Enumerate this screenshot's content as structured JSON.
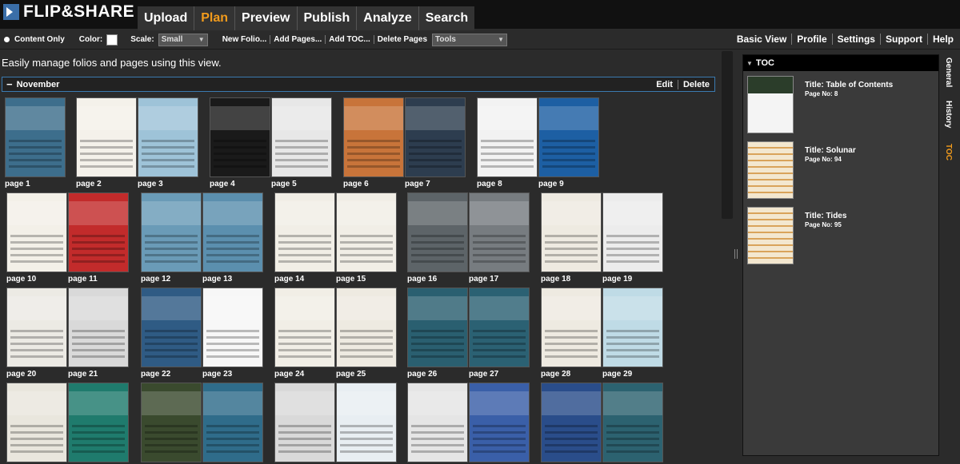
{
  "app": {
    "logo_text": "FLIP&SHARE"
  },
  "main_nav": [
    {
      "label": "Upload",
      "active": false
    },
    {
      "label": "Plan",
      "active": true
    },
    {
      "label": "Preview",
      "active": false
    },
    {
      "label": "Publish",
      "active": false
    },
    {
      "label": "Analyze",
      "active": false
    },
    {
      "label": "Search",
      "active": false
    }
  ],
  "toolbar": {
    "content_only": "Content Only",
    "color_label": "Color:",
    "scale_label": "Scale:",
    "scale_value": "Small",
    "actions": [
      "New Folio...",
      "Add Pages...",
      "Add TOC...",
      "Delete Pages"
    ],
    "tools_value": "Tools"
  },
  "right_nav": [
    "Basic View",
    "Profile",
    "Settings",
    "Support",
    "Help"
  ],
  "intro_text": "Easily manage folios and pages using this view.",
  "folio": {
    "name": "November",
    "edit": "Edit",
    "delete": "Delete"
  },
  "pages": [
    "page 1",
    "page 2",
    "page 3",
    "page 4",
    "page 5",
    "page 6",
    "page 7",
    "page 8",
    "page 9",
    "page 10",
    "page 11",
    "page 12",
    "page 13",
    "page 14",
    "page 15",
    "page 16",
    "page 17",
    "page 18",
    "page 19",
    "page 20",
    "page 21",
    "page 22",
    "page 23",
    "page 24",
    "page 25",
    "page 26",
    "page 27",
    "page 28",
    "page 29",
    "",
    "",
    "",
    "",
    "",
    "",
    "",
    "",
    "",
    ""
  ],
  "thumb_colors": [
    "#3d6e8c",
    "#f4f1ea",
    "#9ec3d8",
    "#1a1a1a",
    "#e7e7e7",
    "#c8743a",
    "#2d3d4f",
    "#f2f2f2",
    "#1d5fa3",
    "#f3f0e8",
    "#c22b2b",
    "#6a9bb7",
    "#5b8fae",
    "#f1eee6",
    "#f1eee6",
    "#5d6468",
    "#777c80",
    "#eeeae1",
    "#ececec",
    "#eceae4",
    "#d9d9d9",
    "#2f5b84",
    "#f7f7f7",
    "#f1eee6",
    "#eeeae1",
    "#2a5f70",
    "#2b6173",
    "#eeeae1",
    "#bfdbe6",
    "#e9e6dd",
    "#1f7b6d",
    "#3a4a2e",
    "#2f6c8a",
    "#d9d9d9",
    "#e8eef2",
    "#e5e5e5",
    "#3a5fa8",
    "#2a4d8a",
    "#2c6270"
  ],
  "toc": {
    "header": "TOC",
    "items": [
      {
        "title": "Title: Table of Contents",
        "page_no": "Page No: 8"
      },
      {
        "title": "Title: Solunar",
        "page_no": "Page No: 94"
      },
      {
        "title": "Title: Tides",
        "page_no": "Page No: 95"
      }
    ]
  },
  "side_tabs": [
    {
      "label": "General",
      "active": false
    },
    {
      "label": "History",
      "active": false
    },
    {
      "label": "TOC",
      "active": true
    }
  ],
  "colors": {
    "accent": "#f29b1c",
    "folio_border": "#3b7bb0",
    "background": "#2b2b2b"
  }
}
